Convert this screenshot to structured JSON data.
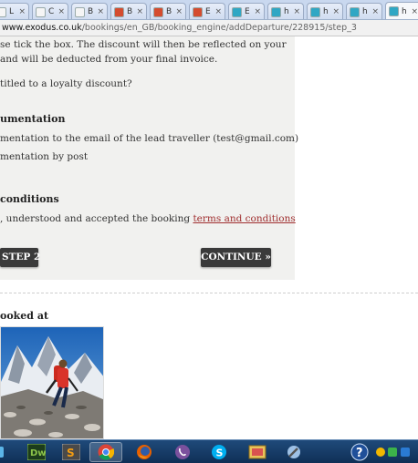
{
  "browser": {
    "tabs": [
      {
        "label": "L",
        "icon": "page-icon",
        "favicon_color": "#f5f5f5"
      },
      {
        "label": "C",
        "icon": "page-icon",
        "favicon_color": "#f5f5f5"
      },
      {
        "label": "B",
        "icon": "page-icon",
        "favicon_color": "#f5f5f5"
      },
      {
        "label": "B",
        "icon": "gmail-icon",
        "favicon_color": "#d44c2f"
      },
      {
        "label": "B",
        "icon": "gmail-icon",
        "favicon_color": "#d44c2f"
      },
      {
        "label": "E",
        "icon": "gmail-icon",
        "favicon_color": "#d44c2f"
      },
      {
        "label": "E",
        "icon": "exodus-icon",
        "favicon_color": "#2fa7c4"
      },
      {
        "label": "h",
        "icon": "exodus-icon",
        "favicon_color": "#2fa7c4"
      },
      {
        "label": "h",
        "icon": "exodus-icon",
        "favicon_color": "#2fa7c4"
      },
      {
        "label": "h",
        "icon": "exodus-icon",
        "favicon_color": "#2fa7c4"
      },
      {
        "label": "h",
        "icon": "exodus-icon",
        "favicon_color": "#2fa7c4"
      }
    ],
    "close_glyph": "×",
    "url_domain": "www.exodus.co.uk",
    "url_path": "/bookings/en_GB/booking_engine/addDeparture/228915/step_3"
  },
  "page": {
    "discount_line1": "se tick the box. The discount will then be reflected on your",
    "discount_line2": "and will be deducted from your final invoice.",
    "loyalty_question": "titled to a loyalty discount?",
    "documentation_heading": "umentation",
    "doc_option_email": "mentation to the email of the lead traveller (test@gmail.com)",
    "doc_option_post": "mentation by post",
    "conditions_heading": "conditions",
    "conditions_text": ", understood and accepted the booking ",
    "conditions_link": "terms and conditions",
    "back_button": "STEP 2",
    "continue_button": "CONTINUE",
    "continue_glyph": "»",
    "booked_heading": "ooked at"
  },
  "colors": {
    "link": "#a03030",
    "button_bg": "#3a3a3a",
    "panel_bg": "#f1f1ef"
  },
  "taskbar": {
    "apps": [
      "dreamweaver-icon",
      "sublime-icon",
      "chrome-icon",
      "firefox-icon",
      "viber-icon",
      "skype-icon",
      "photos-icon",
      "tools-icon"
    ],
    "dreamweaver_label": "Dw",
    "sublime_label": "S",
    "skype_label": "S",
    "help_label": "?"
  }
}
